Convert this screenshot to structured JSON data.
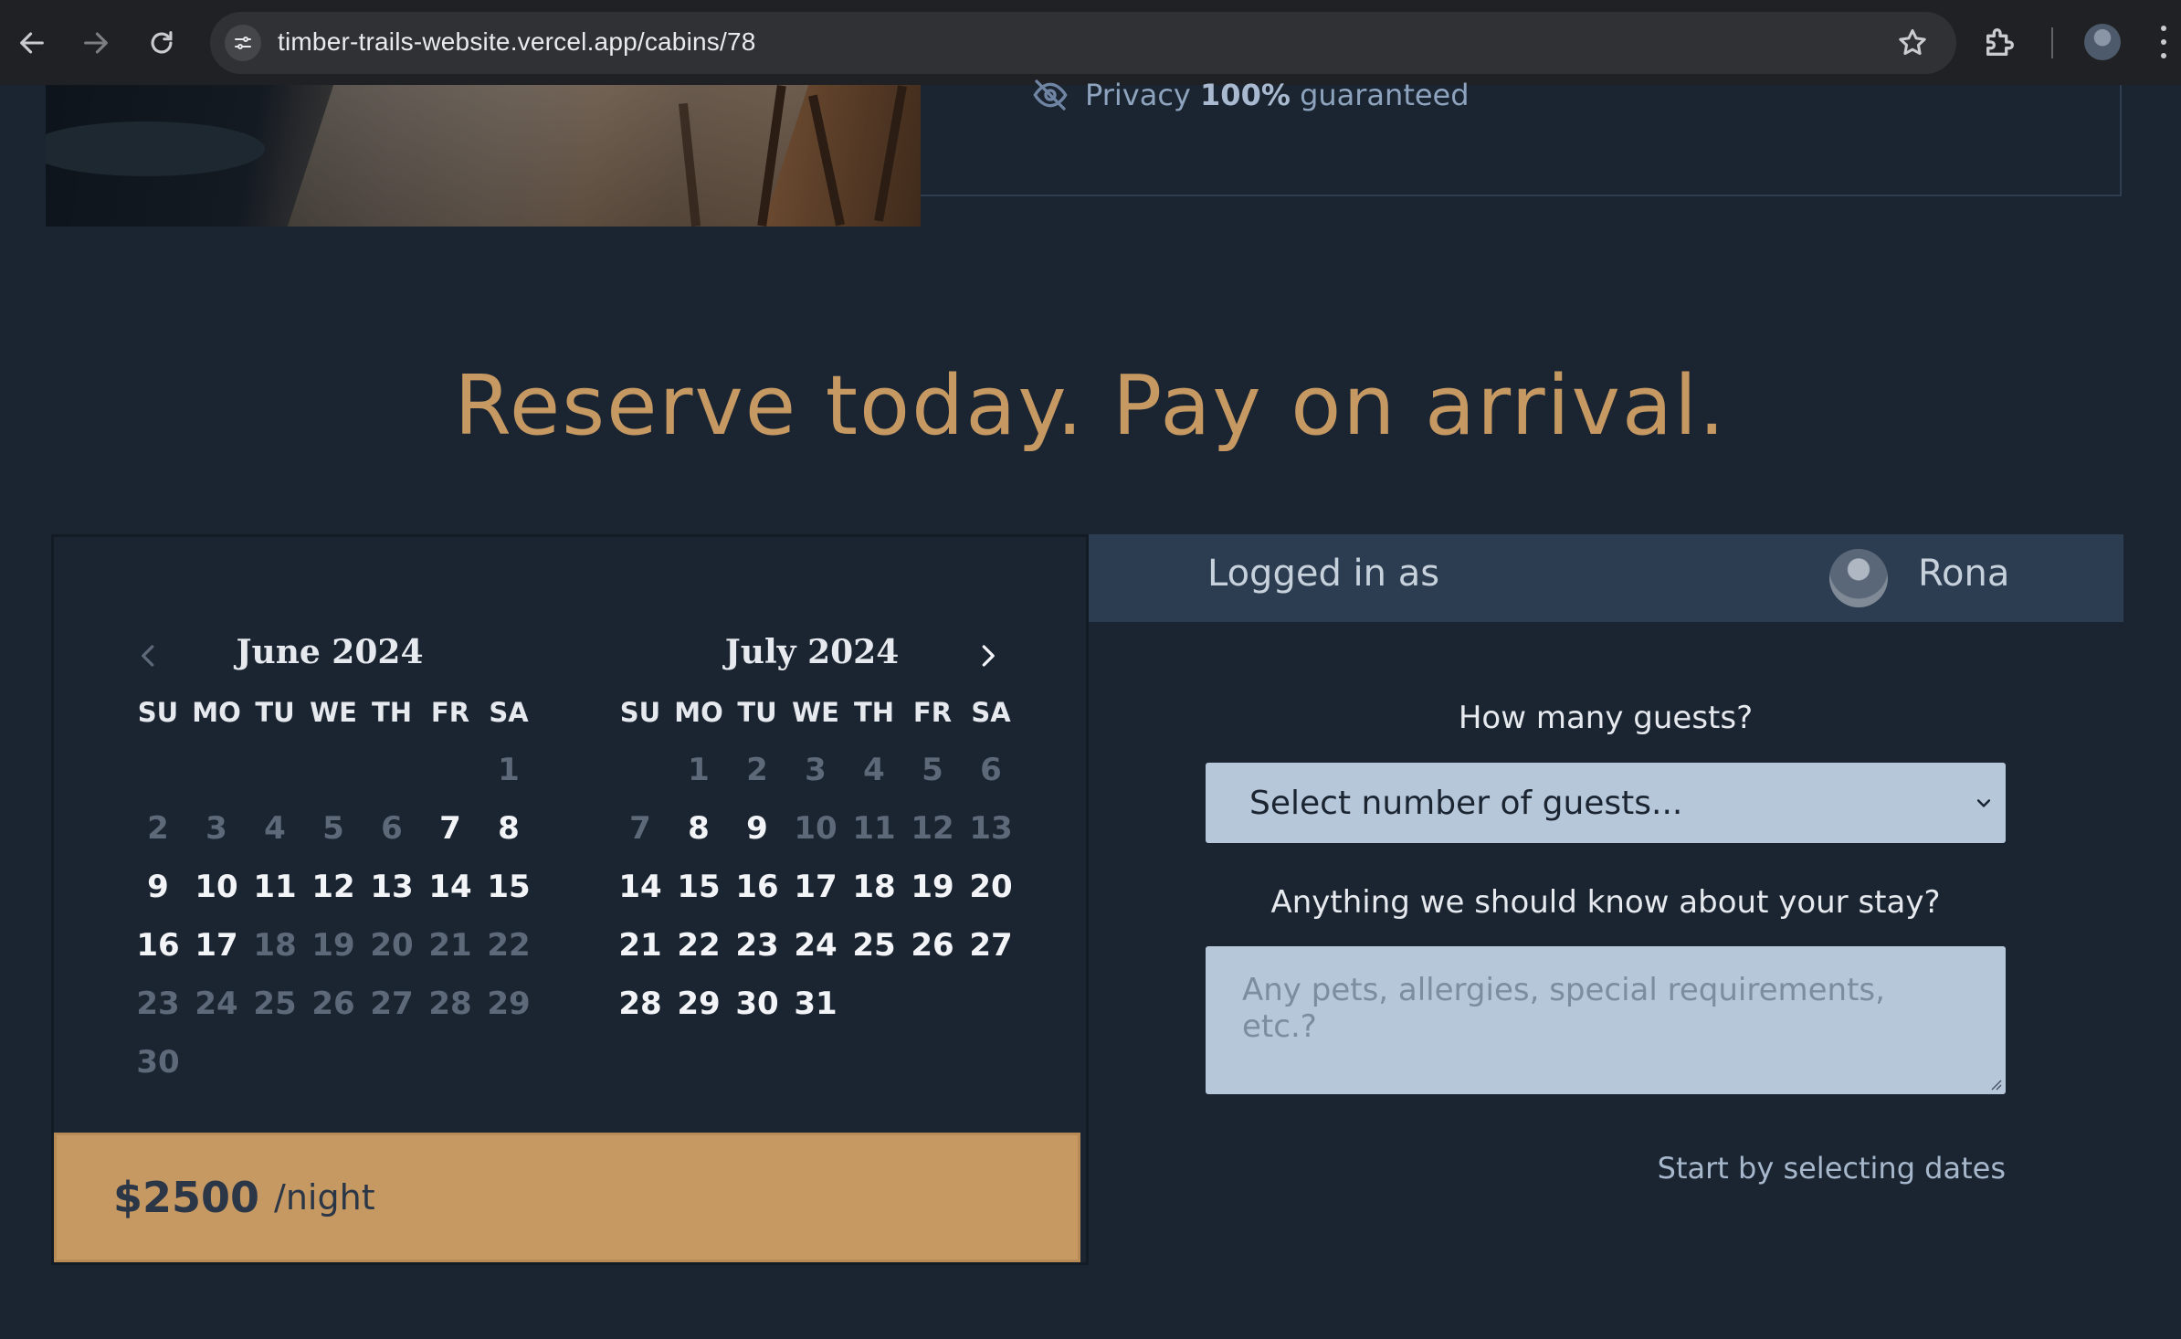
{
  "browser": {
    "url": "timber-trails-website.vercel.app/cabins/78",
    "icons": [
      "back-icon",
      "forward-icon",
      "reload-icon",
      "site-settings-icon",
      "star-icon",
      "extensions-icon",
      "profile-avatar",
      "menu-icon"
    ]
  },
  "info": {
    "privacy_prefix": "Privacy",
    "privacy_bold": "100%",
    "privacy_suffix": "guaranteed"
  },
  "heading": "Reserve today. Pay on arrival.",
  "calendar": {
    "months": [
      {
        "caption": "June 2024",
        "weekdays": [
          "SU",
          "MO",
          "TU",
          "WE",
          "TH",
          "FR",
          "SA"
        ],
        "leading_blanks": 6,
        "days": [
          {
            "d": "1",
            "s": "dis"
          },
          {
            "d": "2",
            "s": "dis"
          },
          {
            "d": "3",
            "s": "dis"
          },
          {
            "d": "4",
            "s": "dis"
          },
          {
            "d": "5",
            "s": "dis"
          },
          {
            "d": "6",
            "s": "dis"
          },
          {
            "d": "7",
            "s": "avail"
          },
          {
            "d": "8",
            "s": "avail"
          },
          {
            "d": "9",
            "s": "avail"
          },
          {
            "d": "10",
            "s": "avail"
          },
          {
            "d": "11",
            "s": "avail"
          },
          {
            "d": "12",
            "s": "avail"
          },
          {
            "d": "13",
            "s": "avail"
          },
          {
            "d": "14",
            "s": "avail"
          },
          {
            "d": "15",
            "s": "avail"
          },
          {
            "d": "16",
            "s": "avail"
          },
          {
            "d": "17",
            "s": "avail"
          },
          {
            "d": "18",
            "s": "dis"
          },
          {
            "d": "19",
            "s": "dis"
          },
          {
            "d": "20",
            "s": "dis"
          },
          {
            "d": "21",
            "s": "dis"
          },
          {
            "d": "22",
            "s": "dis"
          },
          {
            "d": "23",
            "s": "dis"
          },
          {
            "d": "24",
            "s": "dis"
          },
          {
            "d": "25",
            "s": "dis"
          },
          {
            "d": "26",
            "s": "dis"
          },
          {
            "d": "27",
            "s": "dis"
          },
          {
            "d": "28",
            "s": "dis"
          },
          {
            "d": "29",
            "s": "dis"
          },
          {
            "d": "30",
            "s": "dis"
          }
        ]
      },
      {
        "caption": "July 2024",
        "weekdays": [
          "SU",
          "MO",
          "TU",
          "WE",
          "TH",
          "FR",
          "SA"
        ],
        "leading_blanks": 1,
        "days": [
          {
            "d": "1",
            "s": "dis"
          },
          {
            "d": "2",
            "s": "dis"
          },
          {
            "d": "3",
            "s": "dis"
          },
          {
            "d": "4",
            "s": "dis"
          },
          {
            "d": "5",
            "s": "dis"
          },
          {
            "d": "6",
            "s": "dis"
          },
          {
            "d": "7",
            "s": "dis"
          },
          {
            "d": "8",
            "s": "avail"
          },
          {
            "d": "9",
            "s": "avail"
          },
          {
            "d": "10",
            "s": "dis"
          },
          {
            "d": "11",
            "s": "dis"
          },
          {
            "d": "12",
            "s": "dis"
          },
          {
            "d": "13",
            "s": "dis"
          },
          {
            "d": "14",
            "s": "avail"
          },
          {
            "d": "15",
            "s": "avail"
          },
          {
            "d": "16",
            "s": "avail"
          },
          {
            "d": "17",
            "s": "avail"
          },
          {
            "d": "18",
            "s": "avail"
          },
          {
            "d": "19",
            "s": "avail"
          },
          {
            "d": "20",
            "s": "avail"
          },
          {
            "d": "21",
            "s": "avail"
          },
          {
            "d": "22",
            "s": "avail"
          },
          {
            "d": "23",
            "s": "avail"
          },
          {
            "d": "24",
            "s": "avail"
          },
          {
            "d": "25",
            "s": "avail"
          },
          {
            "d": "26",
            "s": "avail"
          },
          {
            "d": "27",
            "s": "avail"
          },
          {
            "d": "28",
            "s": "avail"
          },
          {
            "d": "29",
            "s": "avail"
          },
          {
            "d": "30",
            "s": "avail"
          },
          {
            "d": "31",
            "s": "avail"
          }
        ]
      }
    ],
    "price": "$2500",
    "price_unit": "/night"
  },
  "booking": {
    "logged_in_label": "Logged in as",
    "user_name": "Rona",
    "guests_label": "How many guests?",
    "guests_value": "Select number of guests...",
    "notes_label": "Anything we should know about your stay?",
    "notes_placeholder": "Any pets, allergies, special requirements, etc.?",
    "hint": "Start by selecting dates"
  },
  "colors": {
    "background": "#1b2532",
    "accent": "#c69963",
    "input_bg": "#b7c7da",
    "header_bar": "#2c3d52"
  }
}
